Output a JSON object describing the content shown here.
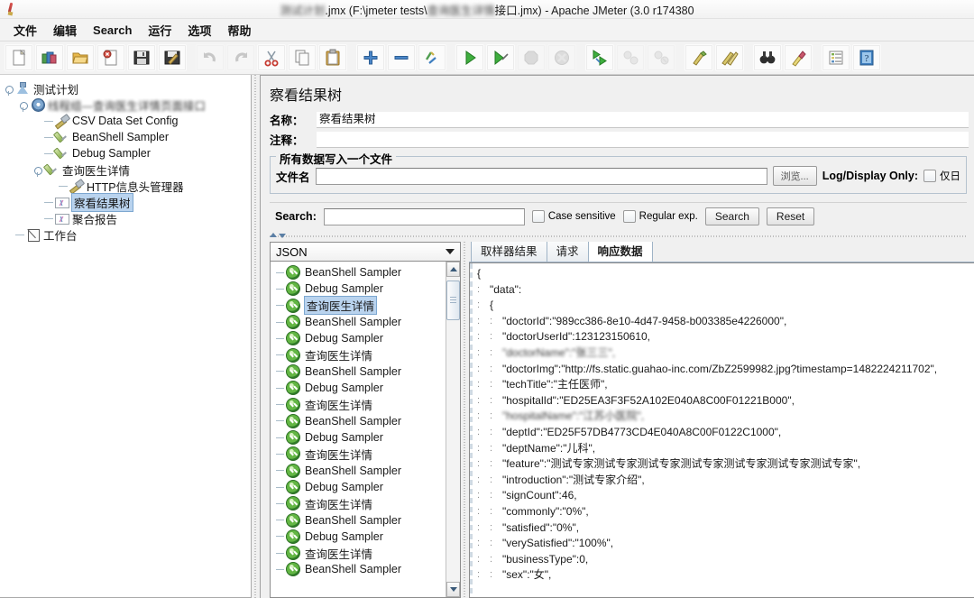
{
  "window": {
    "title_visible_suffix": ".jmx (F:\\jmeter tests\\",
    "title_obscured_1": "测试计划",
    "title_obscured_2": "查询医生详情",
    "title_tail": "接口.jmx) - Apache JMeter (3.0 r174380",
    "app_name": "Apache JMeter",
    "app_version": "3.0 r174380"
  },
  "menubar": {
    "items": [
      {
        "label": "文件",
        "name": "menu-file"
      },
      {
        "label": "编辑",
        "name": "menu-edit"
      },
      {
        "label": "Search",
        "name": "menu-search"
      },
      {
        "label": "运行",
        "name": "menu-run"
      },
      {
        "label": "选项",
        "name": "menu-options"
      },
      {
        "label": "帮助",
        "name": "menu-help"
      }
    ]
  },
  "toolbar": {
    "buttons": [
      {
        "name": "new-icon",
        "glyph": "new",
        "enabled": true
      },
      {
        "name": "templates-icon",
        "glyph": "templates",
        "enabled": true
      },
      {
        "name": "open-icon",
        "glyph": "open",
        "enabled": true
      },
      {
        "name": "close-icon",
        "glyph": "close",
        "enabled": true
      },
      {
        "name": "save-icon",
        "glyph": "save",
        "enabled": true
      },
      {
        "name": "save-as-icon",
        "glyph": "saveas",
        "enabled": true
      },
      {
        "name": "sep1",
        "glyph": "sep",
        "enabled": true
      },
      {
        "name": "undo-icon",
        "glyph": "undo",
        "enabled": false
      },
      {
        "name": "redo-icon",
        "glyph": "redo",
        "enabled": false
      },
      {
        "name": "cut-icon",
        "glyph": "cut",
        "enabled": true
      },
      {
        "name": "copy-icon",
        "glyph": "copy",
        "enabled": true
      },
      {
        "name": "paste-icon",
        "glyph": "paste",
        "enabled": true
      },
      {
        "name": "sep2",
        "glyph": "sep",
        "enabled": true
      },
      {
        "name": "expand-all-icon",
        "glyph": "plus",
        "enabled": true
      },
      {
        "name": "collapse-all-icon",
        "glyph": "minus",
        "enabled": true
      },
      {
        "name": "toggle-icon",
        "glyph": "toggle",
        "enabled": true
      },
      {
        "name": "sep3",
        "glyph": "sep",
        "enabled": true
      },
      {
        "name": "start-icon",
        "glyph": "start",
        "enabled": true
      },
      {
        "name": "start-no-pause-icon",
        "glyph": "startnopause",
        "enabled": true
      },
      {
        "name": "stop-icon",
        "glyph": "stop",
        "enabled": false
      },
      {
        "name": "shutdown-icon",
        "glyph": "shutdown",
        "enabled": false
      },
      {
        "name": "sep4",
        "glyph": "sep",
        "enabled": true
      },
      {
        "name": "remote-start-all-icon",
        "glyph": "remotestart",
        "enabled": true
      },
      {
        "name": "remote-stop-all-icon",
        "glyph": "remotestop",
        "enabled": false
      },
      {
        "name": "remote-shutdown-all-icon",
        "glyph": "remoteshutdown",
        "enabled": false
      },
      {
        "name": "sep5",
        "glyph": "sep",
        "enabled": true
      },
      {
        "name": "clear-icon",
        "glyph": "clear",
        "enabled": true
      },
      {
        "name": "clear-all-icon",
        "glyph": "clearall",
        "enabled": true
      },
      {
        "name": "sep6",
        "glyph": "sep",
        "enabled": true
      },
      {
        "name": "search-icon",
        "glyph": "binoculars",
        "enabled": true
      },
      {
        "name": "search-reset-icon",
        "glyph": "broom",
        "enabled": true
      },
      {
        "name": "sep7",
        "glyph": "sep",
        "enabled": true
      },
      {
        "name": "function-helper-icon",
        "glyph": "list",
        "enabled": true
      },
      {
        "name": "help-icon",
        "glyph": "help",
        "enabled": true
      }
    ]
  },
  "tree": {
    "nodes": [
      {
        "label": "测试计划",
        "icon": "test-plan-icon",
        "depth": 0,
        "handle": "expanded",
        "blur": false,
        "selected": false
      },
      {
        "label": "线程组—查询医生详情页面接口",
        "icon": "thread-group-icon",
        "depth": 1,
        "handle": "expanded",
        "blur": true,
        "selected": false
      },
      {
        "label": "CSV Data Set Config",
        "icon": "config-element-icon",
        "depth": 2,
        "handle": "none",
        "blur": false,
        "selected": false
      },
      {
        "label": "BeanShell Sampler",
        "icon": "sampler-icon",
        "depth": 2,
        "handle": "none",
        "blur": false,
        "selected": false
      },
      {
        "label": "Debug Sampler",
        "icon": "sampler-icon",
        "depth": 2,
        "handle": "none",
        "blur": false,
        "selected": false
      },
      {
        "label": "查询医生详情",
        "icon": "sampler-icon",
        "depth": 2,
        "handle": "expanded",
        "blur": false,
        "selected": false
      },
      {
        "label": "HTTP信息头管理器",
        "icon": "config-element-icon",
        "depth": 3,
        "handle": "none",
        "blur": false,
        "selected": false
      },
      {
        "label": "察看结果树",
        "icon": "listener-icon",
        "depth": 2,
        "handle": "none",
        "blur": false,
        "selected": true
      },
      {
        "label": "聚合报告",
        "icon": "listener-icon",
        "depth": 2,
        "handle": "none",
        "blur": false,
        "selected": false
      },
      {
        "label": "工作台",
        "icon": "workbench-icon",
        "depth": 0,
        "handle": "none",
        "blur": false,
        "selected": false
      }
    ]
  },
  "panel": {
    "title": "察看结果树",
    "name_label": "名称：",
    "name_value": "察看结果树",
    "comment_label": "注释：",
    "comment_value": "",
    "file_group_title": "所有数据写入一个文件",
    "filename_label": "文件名",
    "filename_value": "",
    "browse_label": "浏览...",
    "log_display_only_label": "Log/Display Only:",
    "errors_only_label": "仅日"
  },
  "search": {
    "label": "Search:",
    "value": "",
    "case_sensitive_label": "Case sensitive",
    "case_sensitive_checked": false,
    "regular_exp_label": "Regular exp.",
    "regular_exp_checked": false,
    "search_button": "Search",
    "reset_button": "Reset"
  },
  "renderer": {
    "selected": "JSON"
  },
  "tabs": [
    {
      "label": "取样器结果",
      "name": "tab-sampler-result",
      "active": false
    },
    {
      "label": "请求",
      "name": "tab-request",
      "active": false
    },
    {
      "label": "响应数据",
      "name": "tab-response-data",
      "active": true
    }
  ],
  "result_tree": {
    "items": [
      {
        "label": "BeanShell Sampler",
        "status": "success",
        "selected": false
      },
      {
        "label": "Debug Sampler",
        "status": "success",
        "selected": false
      },
      {
        "label": "查询医生详情",
        "status": "success",
        "selected": true
      },
      {
        "label": "BeanShell Sampler",
        "status": "success",
        "selected": false
      },
      {
        "label": "Debug Sampler",
        "status": "success",
        "selected": false
      },
      {
        "label": "查询医生详情",
        "status": "success",
        "selected": false
      },
      {
        "label": "BeanShell Sampler",
        "status": "success",
        "selected": false
      },
      {
        "label": "Debug Sampler",
        "status": "success",
        "selected": false
      },
      {
        "label": "查询医生详情",
        "status": "success",
        "selected": false
      },
      {
        "label": "BeanShell Sampler",
        "status": "success",
        "selected": false
      },
      {
        "label": "Debug Sampler",
        "status": "success",
        "selected": false
      },
      {
        "label": "查询医生详情",
        "status": "success",
        "selected": false
      },
      {
        "label": "BeanShell Sampler",
        "status": "success",
        "selected": false
      },
      {
        "label": "Debug Sampler",
        "status": "success",
        "selected": false
      },
      {
        "label": "查询医生详情",
        "status": "success",
        "selected": false
      },
      {
        "label": "BeanShell Sampler",
        "status": "success",
        "selected": false
      },
      {
        "label": "Debug Sampler",
        "status": "success",
        "selected": false
      },
      {
        "label": "查询医生详情",
        "status": "success",
        "selected": false
      },
      {
        "label": "BeanShell Sampler",
        "status": "success",
        "selected": false
      }
    ]
  },
  "response_json": {
    "lines": [
      {
        "indent": 0,
        "text": "{",
        "blur": false
      },
      {
        "indent": 1,
        "text": "\"data\":",
        "blur": false
      },
      {
        "indent": 1,
        "text": "{",
        "blur": false
      },
      {
        "indent": 2,
        "text": "\"doctorId\":\"989cc386-8e10-4d47-9458-b003385e4226000\",",
        "blur": false
      },
      {
        "indent": 2,
        "text": "\"doctorUserId\":123123150610,",
        "blur": false
      },
      {
        "indent": 2,
        "text": "\"doctorName\":\"张三三\",",
        "blur": true
      },
      {
        "indent": 2,
        "text": "\"doctorImg\":\"http://fs.static.guahao-inc.com/ZbZ2599982.jpg?timestamp=1482224211702\",",
        "blur": false
      },
      {
        "indent": 2,
        "text": "\"techTitle\":\"主任医师\",",
        "blur": false
      },
      {
        "indent": 2,
        "text": "\"hospitalId\":\"ED25EA3F3F52A102E040A8C00F01221B000\",",
        "blur": false
      },
      {
        "indent": 2,
        "text": "\"hospitalName\":\"江苏小医院\",",
        "blur": true
      },
      {
        "indent": 2,
        "text": "\"deptId\":\"ED25F57DB4773CD4E040A8C00F0122C1000\",",
        "blur": false
      },
      {
        "indent": 2,
        "text": "\"deptName\":\"儿科\",",
        "blur": false
      },
      {
        "indent": 2,
        "text": "\"feature\":\"测试专家测试专家测试专家测试专家测试专家测试专家测试专家\",",
        "blur": false
      },
      {
        "indent": 2,
        "text": "\"introduction\":\"测试专家介绍\",",
        "blur": false
      },
      {
        "indent": 2,
        "text": "\"signCount\":46,",
        "blur": false
      },
      {
        "indent": 2,
        "text": "\"commonly\":\"0%\",",
        "blur": false
      },
      {
        "indent": 2,
        "text": "\"satisfied\":\"0%\",",
        "blur": false
      },
      {
        "indent": 2,
        "text": "\"verySatisfied\":\"100%\",",
        "blur": false
      },
      {
        "indent": 2,
        "text": "\"businessType\":0,",
        "blur": false
      },
      {
        "indent": 2,
        "text": "\"sex\":\"女\",",
        "blur": false
      }
    ]
  },
  "colors": {
    "panel_bg": "#f0f0f0",
    "selection": "#b9d3ee",
    "success_green": "#63b644",
    "tab_border": "#9fb3c6"
  }
}
